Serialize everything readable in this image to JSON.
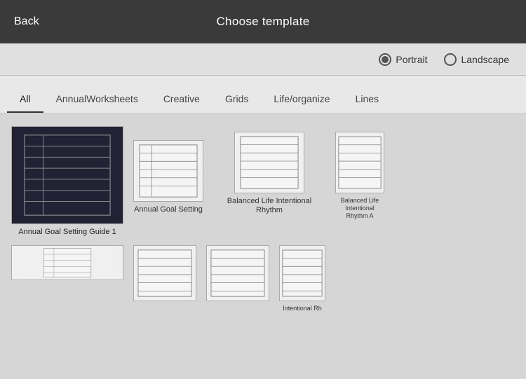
{
  "header": {
    "title": "Choose template",
    "back_label": "Back"
  },
  "orientation": {
    "portrait_label": "Portrait",
    "landscape_label": "Landscape",
    "selected": "portrait"
  },
  "tabs": [
    {
      "id": "all",
      "label": "All",
      "active": true
    },
    {
      "id": "annual",
      "label": "AnnualWorksheets",
      "active": false
    },
    {
      "id": "creative",
      "label": "Creative",
      "active": false
    },
    {
      "id": "grids",
      "label": "Grids",
      "active": false
    },
    {
      "id": "life",
      "label": "Life/organize",
      "active": false
    },
    {
      "id": "lines",
      "label": "Lines",
      "active": false
    }
  ],
  "templates": {
    "row1": [
      {
        "id": "t1",
        "label": "Annual Goal Setting Guide 1",
        "selected": true
      },
      {
        "id": "t2",
        "label": "Annual Goal Setting",
        "selected": false
      },
      {
        "id": "t3",
        "label": "Balanced Life Intentional Rhythm",
        "selected": false
      },
      {
        "id": "t4",
        "label": "Balanced Life Intentional Rhythm A",
        "selected": false
      }
    ],
    "row2": [
      {
        "id": "t5",
        "label": "",
        "selected": false
      },
      {
        "id": "t6",
        "label": "",
        "selected": false
      },
      {
        "id": "t7",
        "label": "",
        "selected": false
      },
      {
        "id": "t8",
        "label": "Intentional Rh",
        "selected": false
      }
    ]
  }
}
